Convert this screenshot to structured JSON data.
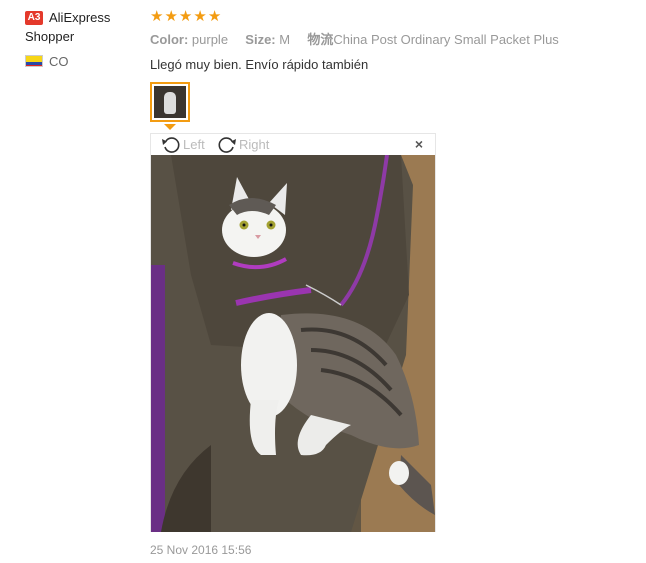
{
  "reviewer": {
    "badge": "A3",
    "name_line1": "AliExpress",
    "name_line2": "Shopper",
    "country": "CO"
  },
  "rating": {
    "stars": 5,
    "max": 5
  },
  "attributes": {
    "color_label": "Color:",
    "color_value": "purple",
    "size_label": "Size:",
    "size_value": "M",
    "shipping_label": "物流",
    "shipping_value": "China Post Ordinary Small Packet Plus"
  },
  "review_text": "Llegó muy bien. Envío rápido también",
  "viewer": {
    "rotate_left_label": "Left",
    "rotate_right_label": "Right",
    "close_label": "×"
  },
  "date": "25 Nov 2016 15:56",
  "colors": {
    "accent": "#f39c12",
    "badge": "#e4392b",
    "muted_text": "#999999"
  }
}
